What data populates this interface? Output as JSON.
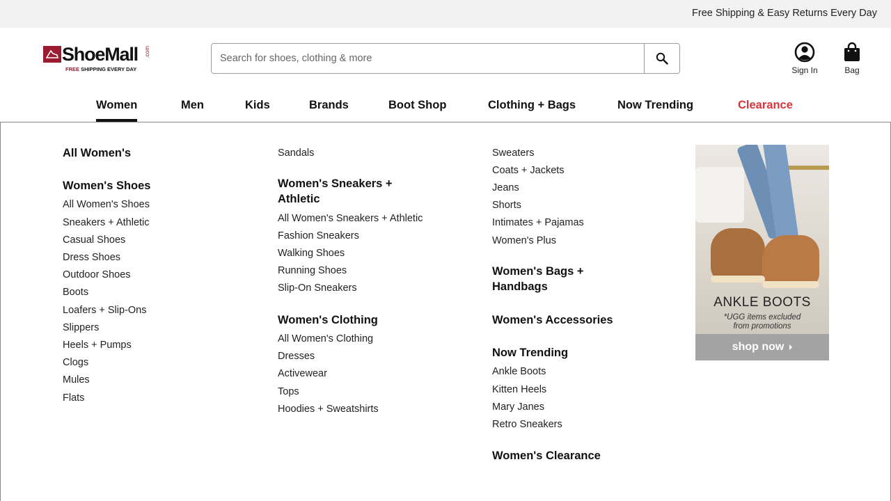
{
  "promo_bar": {
    "text": "Free Shipping & Easy Returns Every Day"
  },
  "logo": {
    "brand": "ShoeMall",
    "suffix": ".com",
    "tagline_free": "FREE",
    "tagline_rest": "SHIPPING EVERY DAY"
  },
  "search": {
    "placeholder": "Search for shoes, clothing & more",
    "value": "",
    "button_icon": "search-icon"
  },
  "account": {
    "sign_in_label": "Sign In",
    "sign_in_icon": "user-circle-icon",
    "bag_label": "Bag",
    "bag_icon": "shopping-bag-icon"
  },
  "nav": {
    "items": [
      {
        "label": "Women",
        "active": true
      },
      {
        "label": "Men"
      },
      {
        "label": "Kids"
      },
      {
        "label": "Brands"
      },
      {
        "label": "Boot Shop"
      },
      {
        "label": "Clothing + Bags"
      },
      {
        "label": "Now Trending"
      },
      {
        "label": "Clearance",
        "color": "#d9343a"
      }
    ]
  },
  "menu": {
    "col1": {
      "all_womens": "All Women's",
      "shoes_heading": "Women's Shoes",
      "shoes": [
        "All Women's Shoes",
        "Sneakers + Athletic",
        "Casual Shoes",
        "Dress Shoes",
        "Outdoor Shoes",
        "Boots",
        "Loafers + Slip-Ons",
        "Slippers",
        "Heels + Pumps",
        "Clogs",
        "Mules",
        "Flats"
      ]
    },
    "col2": {
      "sandals": "Sandals",
      "sneakers_heading_line1": "Women's Sneakers +",
      "sneakers_heading_line2": "Athletic",
      "sneakers": [
        "All Women's Sneakers + Athletic",
        "Fashion Sneakers",
        "Walking Shoes",
        "Running Shoes",
        "Slip-On Sneakers"
      ],
      "clothing_heading": "Women's Clothing",
      "clothing": [
        "All Women's Clothing",
        "Dresses",
        "Activewear",
        "Tops",
        "Hoodies + Sweatshirts"
      ]
    },
    "col3": {
      "clothing_more": [
        "Sweaters",
        "Coats + Jackets",
        "Jeans",
        "Shorts",
        "Intimates + Pajamas",
        "Women's Plus"
      ],
      "bags_heading_line1": "Women's Bags +",
      "bags_heading_line2": "Handbags",
      "accessories_heading": "Women's Accessories",
      "trending_heading": "Now Trending",
      "trending": [
        "Ankle Boots",
        "Kitten Heels",
        "Mary Janes",
        "Retro Sneakers"
      ],
      "clearance_heading": "Women's Clearance"
    },
    "promo": {
      "title": "ANKLE BOOTS",
      "note_line1": "*UGG items excluded",
      "note_line2": "from promotions",
      "button": "shop now"
    }
  },
  "colors": {
    "brand": "#9b1b30",
    "clearance": "#d9343a",
    "promo_bar_bg": "#f2f2f2",
    "shop_now_bg": "#a3a3a3"
  }
}
